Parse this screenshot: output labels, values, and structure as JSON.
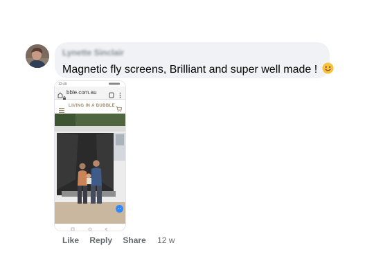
{
  "comment": {
    "author": "Lynette Sinclair",
    "text": "Magnetic fly screens, Brilliant and super well made !",
    "emoji": "smiling-face-emoji"
  },
  "attachment": {
    "url_text": "bble.com.au",
    "site_name": "LIVING IN A BUBBLE"
  },
  "actions": {
    "like": "Like",
    "reply": "Reply",
    "share": "Share",
    "time": "12 w"
  },
  "colors": {
    "bubble": "#f0f2f5",
    "action_text": "#65676b",
    "messenger_badge": "#2d88ff"
  }
}
